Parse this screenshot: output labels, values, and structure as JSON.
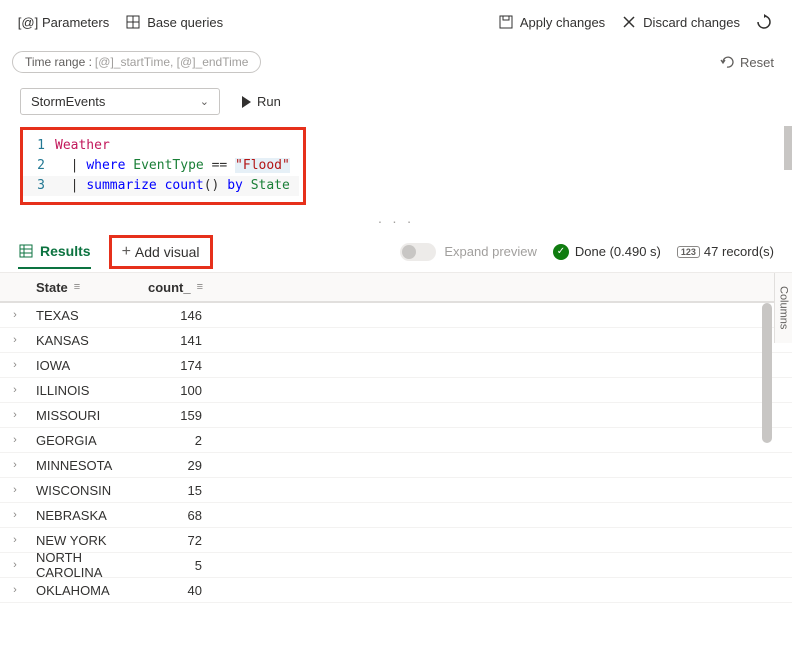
{
  "toolbar": {
    "parameters": "Parameters",
    "base_queries": "Base queries",
    "apply_changes": "Apply changes",
    "discard_changes": "Discard changes"
  },
  "timerange": {
    "label": "Time range :",
    "value": "[@]_startTime, [@]_endTime",
    "reset": "Reset"
  },
  "query": {
    "source_dropdown": "StormEvents",
    "run": "Run",
    "lines": [
      {
        "n": "1",
        "tokens": [
          {
            "t": "Weather",
            "c": "tok-pink"
          }
        ]
      },
      {
        "n": "2",
        "tokens": [
          {
            "t": "| ",
            "c": "tok-op"
          },
          {
            "t": "where ",
            "c": "tok-kw"
          },
          {
            "t": "EventType ",
            "c": "tok-col"
          },
          {
            "t": "== ",
            "c": "tok-op"
          },
          {
            "t": "\"Flood\"",
            "c": "tok-str-hl"
          }
        ]
      },
      {
        "n": "3",
        "tokens": [
          {
            "t": "| ",
            "c": "tok-op"
          },
          {
            "t": "summarize ",
            "c": "tok-kw"
          },
          {
            "t": "count",
            "c": "tok-fn"
          },
          {
            "t": "() ",
            "c": "tok-op"
          },
          {
            "t": "by ",
            "c": "tok-kw"
          },
          {
            "t": "State",
            "c": "tok-col"
          }
        ]
      }
    ]
  },
  "tabs": {
    "results": "Results",
    "add_visual": "Add visual",
    "expand_preview": "Expand preview",
    "status": "Done (0.490 s)",
    "record_count": "47 record(s)"
  },
  "grid": {
    "columns": {
      "state": "State",
      "count": "count_"
    },
    "columns_panel": "Columns",
    "rows": [
      {
        "state": "TEXAS",
        "count": 146
      },
      {
        "state": "KANSAS",
        "count": 141
      },
      {
        "state": "IOWA",
        "count": 174
      },
      {
        "state": "ILLINOIS",
        "count": 100
      },
      {
        "state": "MISSOURI",
        "count": 159
      },
      {
        "state": "GEORGIA",
        "count": 2
      },
      {
        "state": "MINNESOTA",
        "count": 29
      },
      {
        "state": "WISCONSIN",
        "count": 15
      },
      {
        "state": "NEBRASKA",
        "count": 68
      },
      {
        "state": "NEW YORK",
        "count": 72
      },
      {
        "state": "NORTH CAROLINA",
        "count": 5
      },
      {
        "state": "OKLAHOMA",
        "count": 40
      }
    ]
  }
}
